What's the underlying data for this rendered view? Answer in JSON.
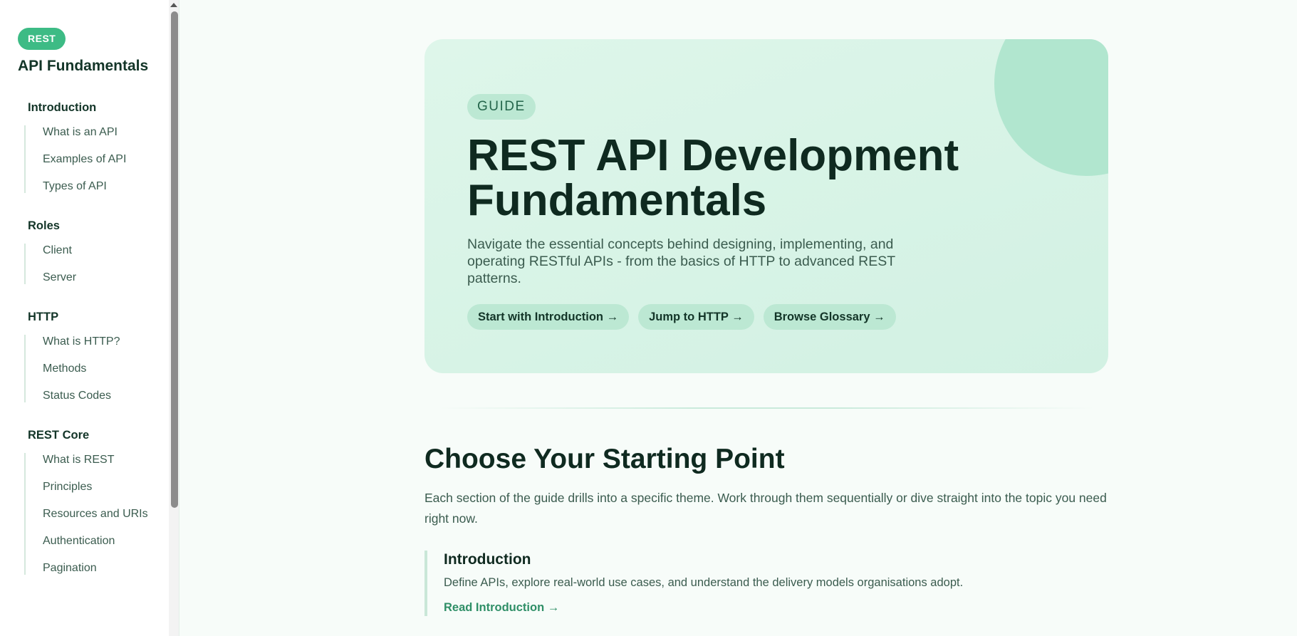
{
  "sidebar": {
    "badge": "REST",
    "title": "API Fundamentals",
    "groups": [
      {
        "title": "Introduction",
        "items": [
          "What is an API",
          "Examples of API",
          "Types of API"
        ]
      },
      {
        "title": "Roles",
        "items": [
          "Client",
          "Server"
        ]
      },
      {
        "title": "HTTP",
        "items": [
          "What is HTTP?",
          "Methods",
          "Status Codes"
        ]
      },
      {
        "title": "REST Core",
        "items": [
          "What is REST",
          "Principles",
          "Resources and URIs",
          "Authentication",
          "Pagination"
        ]
      }
    ]
  },
  "hero": {
    "badge": "GUIDE",
    "title": "REST API Development Fundamentals",
    "lede": "Navigate the essential concepts behind designing, implementing, and operating RESTful APIs - from the basics of HTTP to advanced REST patterns.",
    "ctas": [
      "Start with Introduction →",
      "Jump to HTTP →",
      "Browse Glossary →"
    ]
  },
  "section": {
    "title": "Choose Your Starting Point",
    "lede": "Each section of the guide drills into a specific theme. Work through them sequentially or dive straight into the topic you need right now."
  },
  "cards": [
    {
      "title": "Introduction",
      "description": "Define APIs, explore real-world use cases, and understand the delivery models organisations adopt.",
      "link": "Read Introduction →"
    }
  ],
  "colors": {
    "accent": "#3dbb85",
    "hero_bg": "#d8f3e6",
    "link": "#2f8f67",
    "text": "#0f2a20"
  }
}
